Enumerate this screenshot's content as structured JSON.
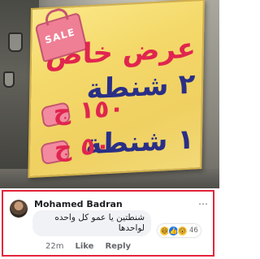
{
  "sign": {
    "sale_badge": "SALE",
    "headline": "عرض خاص",
    "offer_two": "٢ شنطة",
    "price_two": "١٥٠ ج",
    "offer_one": "١ شنطة",
    "price_one": "٥٠ ج"
  },
  "comment": {
    "author": "Mohamed Badran",
    "text": "شنطتين يا عمو كل واحده لواحدها",
    "reaction_count": "46",
    "time": "22m",
    "like_label": "Like",
    "reply_label": "Reply"
  },
  "icons": {
    "haha": "😆",
    "like": "👍",
    "wow": "😮"
  },
  "colors": {
    "highlight_border": "#e4253b",
    "sign_red": "#e0254f",
    "sign_blue": "#2a2f86",
    "sign_yellow": "#f4d96a"
  }
}
